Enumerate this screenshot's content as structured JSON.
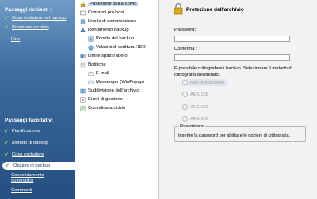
{
  "sidebar": {
    "required_header": "Passaggi richiesti :",
    "required": [
      {
        "label": "Cosa includere nel backup",
        "done": true
      },
      {
        "label": "Posizione archivio",
        "done": true
      }
    ],
    "finish": "Fine",
    "optional_header": "Passaggi facoltativi :",
    "optional": [
      {
        "label": "Pianificazione",
        "done": true
      },
      {
        "label": "Metodo di backup",
        "done": true
      },
      {
        "label": "Cosa escludere",
        "done": true
      },
      {
        "label": "Opzioni di backup",
        "done": true,
        "active": true
      }
    ],
    "optional_sub": [
      {
        "label_line1": "Consolidamento",
        "label_line2": "automatico"
      },
      {
        "label_line1": "Commenti",
        "label_line2": ""
      }
    ]
  },
  "tree": {
    "items": [
      {
        "label": "Protezione dell'archivio",
        "icon": "lock-icon",
        "selected": true
      },
      {
        "label": "Comandi pre/post",
        "icon": "command-icon"
      },
      {
        "label": "Livello di compressione",
        "icon": "compression-icon"
      },
      {
        "label": "Rendimento backup",
        "icon": "performance-icon"
      },
      {
        "label": "Priorità del backup",
        "icon": "priority-icon"
      },
      {
        "label": "Velocità di scrittura HDD",
        "icon": "hdd-speed-icon"
      },
      {
        "label": "Limite spazio libero",
        "icon": "free-space-icon"
      },
      {
        "label": "Notifiche",
        "icon": "notifications-icon"
      },
      {
        "label": "E-mail",
        "icon": "email-icon"
      },
      {
        "label": "Messenger (WinPopup)",
        "icon": "messenger-icon"
      },
      {
        "label": "Suddivisione dell'archivio",
        "icon": "split-icon"
      },
      {
        "label": "Errori di gestione",
        "icon": "error-icon"
      },
      {
        "label": "Convalida archivio",
        "icon": "validate-icon"
      }
    ]
  },
  "content": {
    "title": "Protezione dell'archivio",
    "password_label": "Password:",
    "password_value": "",
    "confirm_label": "Conferma :",
    "confirm_value": "",
    "encryption_text": "È possibile crittografare i backup. Selezionare il metodo di crittografia desiderato.",
    "radios": [
      {
        "label": "Non crittografare",
        "selected": true
      },
      {
        "label": "AES 128"
      },
      {
        "label": "AES 192"
      },
      {
        "label": "AES 256"
      }
    ],
    "description_legend": "Descrizione",
    "description_text": "Inserire la password per abilitare le opzioni di crittografia."
  },
  "colors": {
    "sidebar_top": "#6f9bc6",
    "sidebar_bottom": "#244f80",
    "check_green": "#7ee06a",
    "selection_blue": "#c9dcf3"
  }
}
